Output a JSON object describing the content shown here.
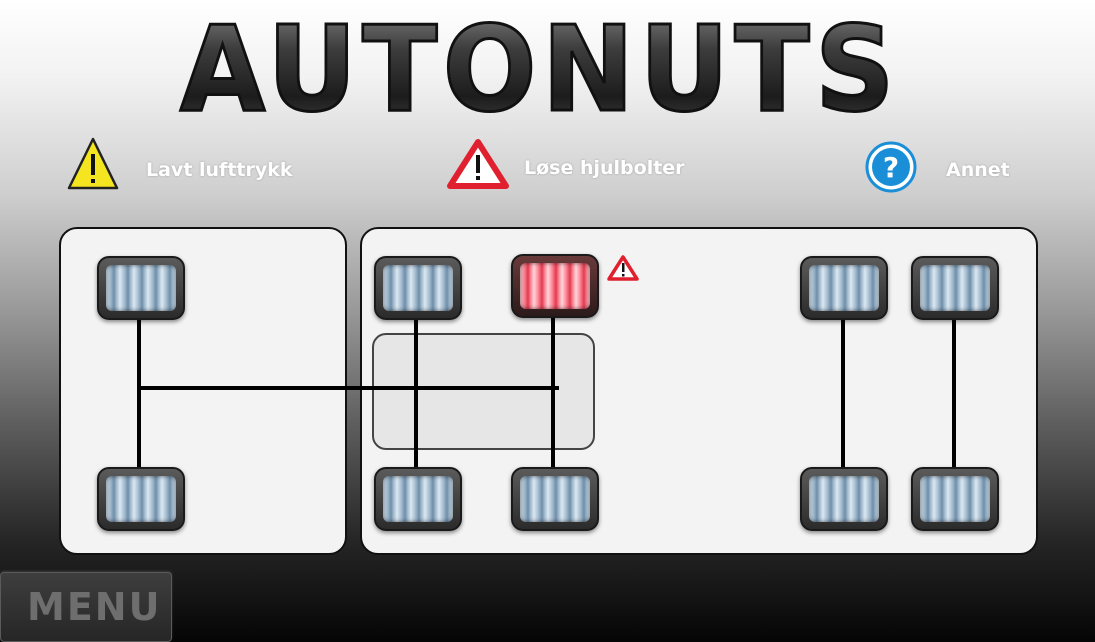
{
  "app": {
    "logo_text": "AUTONUTS"
  },
  "legend": {
    "low_pressure": {
      "label": "Lavt lufttrykk",
      "icon": "warning-yellow-icon",
      "color": "#f4e520"
    },
    "loose_bolts": {
      "label": "Løse hjulbolter",
      "icon": "warning-red-icon",
      "color": "#e0202e"
    },
    "other": {
      "label": "Annet",
      "icon": "help-icon",
      "color": "#1a8fd8"
    }
  },
  "vehicle": {
    "wheels": [
      {
        "id": "trailer-front-left",
        "status": "normal"
      },
      {
        "id": "trailer-front-right",
        "status": "normal"
      },
      {
        "id": "truck-axle1-left",
        "status": "normal"
      },
      {
        "id": "truck-axle1-right",
        "status": "normal"
      },
      {
        "id": "truck-axle2-left",
        "status": "loose-bolts"
      },
      {
        "id": "truck-axle2-right",
        "status": "normal"
      },
      {
        "id": "truck-axle3-left",
        "status": "normal"
      },
      {
        "id": "truck-axle3-right",
        "status": "normal"
      },
      {
        "id": "truck-axle4-left",
        "status": "normal"
      },
      {
        "id": "truck-axle4-right",
        "status": "normal"
      }
    ],
    "status_colors": {
      "normal": "#8fb0c8",
      "loose-bolts": "#e83a52"
    }
  },
  "menu": {
    "label": "MENU"
  }
}
